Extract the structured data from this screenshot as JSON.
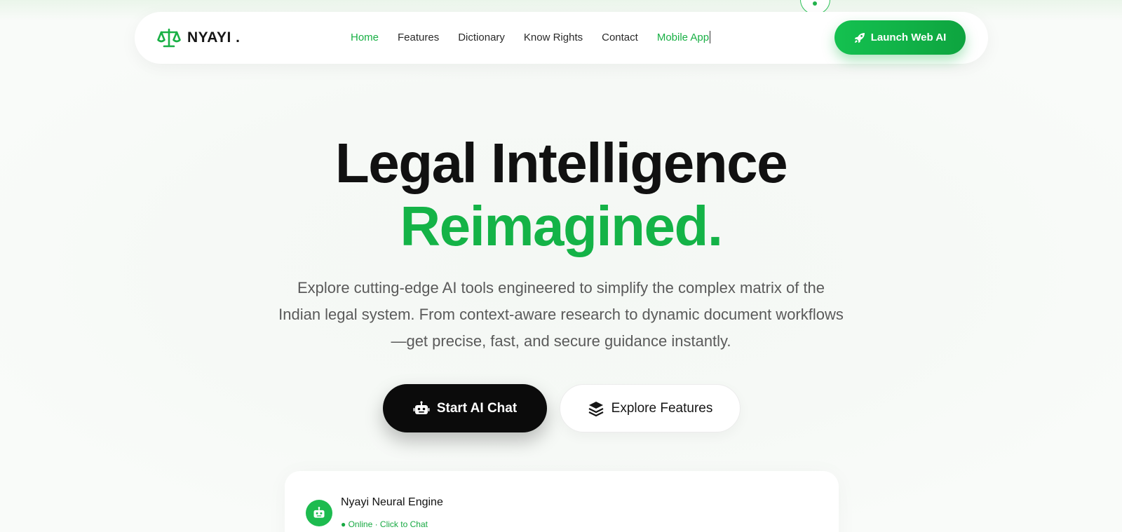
{
  "brand": {
    "name": "NYAYI .",
    "accent_color": "#19b045",
    "logo_icon": "scales-of-justice-icon"
  },
  "nav": {
    "links": [
      {
        "label": "Home",
        "state": "active"
      },
      {
        "label": "Features",
        "state": "default"
      },
      {
        "label": "Dictionary",
        "state": "default"
      },
      {
        "label": "Know Rights",
        "state": "default"
      },
      {
        "label": "Contact",
        "state": "default"
      },
      {
        "label": "Mobile App",
        "state": "highlight"
      }
    ],
    "launch_button": {
      "label": "Launch Web AI",
      "icon": "rocket-icon"
    }
  },
  "hero": {
    "title_line1": "Legal Intelligence",
    "title_line2": "Reimagined.",
    "subtitle": "Explore cutting-edge AI tools engineered to simplify the complex matrix of the Indian legal system. From context-aware research to dynamic document workflows—get precise, fast, and secure guidance instantly.",
    "primary_cta": {
      "label": "Start AI Chat",
      "icon": "robot-icon"
    },
    "secondary_cta": {
      "label": "Explore Features",
      "icon": "layers-icon"
    }
  },
  "chat_preview": {
    "name": "Nyayi Neural Engine",
    "status": "● Online · Click to Chat",
    "avatar_icon": "robot-icon",
    "status_color": "#17a942"
  },
  "colors": {
    "primary_green": "#14b347",
    "dark": "#0b0b0b",
    "text_muted": "#5a5a5a"
  }
}
